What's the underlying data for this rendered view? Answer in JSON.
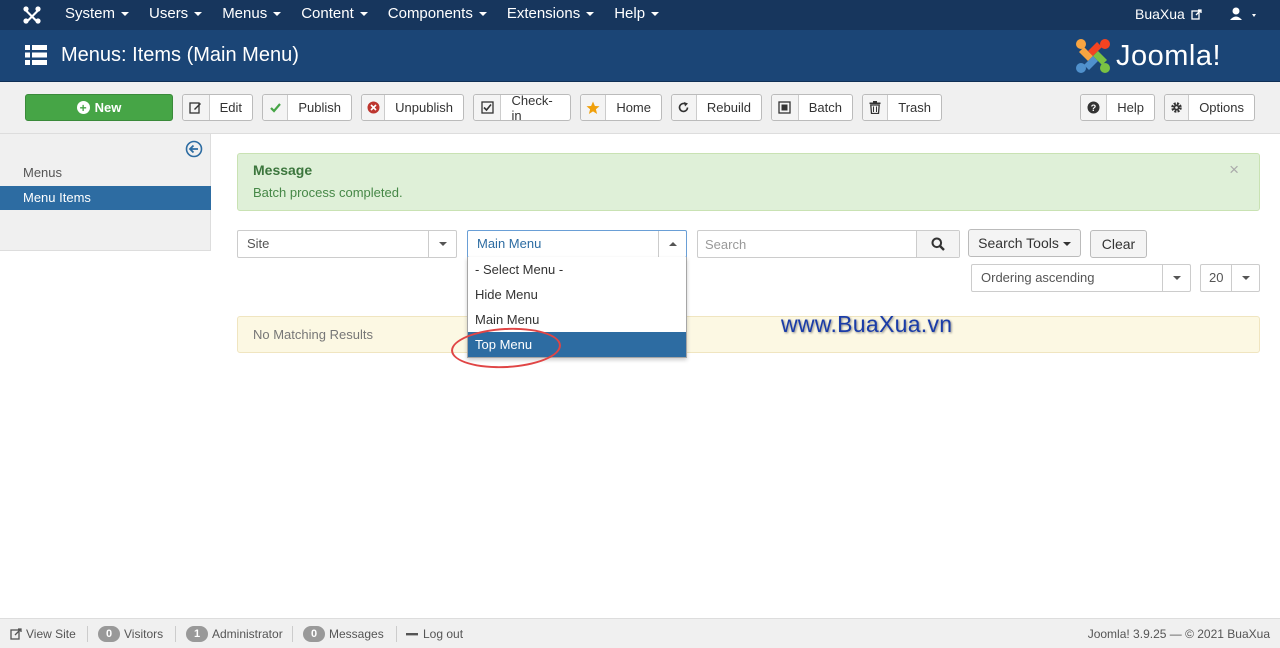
{
  "navbar": {
    "menu": [
      {
        "label": "System"
      },
      {
        "label": "Users"
      },
      {
        "label": "Menus"
      },
      {
        "label": "Content"
      },
      {
        "label": "Components"
      },
      {
        "label": "Extensions"
      },
      {
        "label": "Help"
      }
    ],
    "site_name": "BuaXua"
  },
  "header": {
    "title": "Menus: Items (Main Menu)",
    "brand": "Joomla!"
  },
  "toolbar": {
    "new": "New",
    "edit": "Edit",
    "publish": "Publish",
    "unpublish": "Unpublish",
    "checkin": "Check-in",
    "home": "Home",
    "rebuild": "Rebuild",
    "batch": "Batch",
    "trash": "Trash",
    "help": "Help",
    "options": "Options"
  },
  "sidebar": {
    "items": [
      {
        "label": "Menus"
      },
      {
        "label": "Menu Items"
      }
    ]
  },
  "message": {
    "heading": "Message",
    "body": "Batch process completed.",
    "close": "×"
  },
  "filters": {
    "client": "Site",
    "menu": "Main Menu",
    "menu_options": [
      "- Select Menu -",
      "Hide Menu",
      "Main Menu",
      "Top Menu"
    ],
    "search_placeholder": "Search",
    "search_tools": "Search Tools",
    "clear": "Clear",
    "ordering": "Ordering ascending",
    "limit": "20"
  },
  "results": {
    "empty": "No Matching Results"
  },
  "watermark": "www.BuaXua.vn",
  "statusbar": {
    "view_site": "View Site",
    "visitors_count": "0",
    "visitors": "Visitors",
    "admin_count": "1",
    "admin": "Administrator",
    "messages_count": "0",
    "messages": "Messages",
    "logout": "Log out",
    "version": "Joomla! 3.9.25  —  © 2021 BuaXua"
  },
  "colors": {
    "navbar": "#17365d",
    "header": "#1b4576",
    "accent": "#2d6ca2",
    "success": "#46a546",
    "highlight_ring": "#e04545"
  }
}
